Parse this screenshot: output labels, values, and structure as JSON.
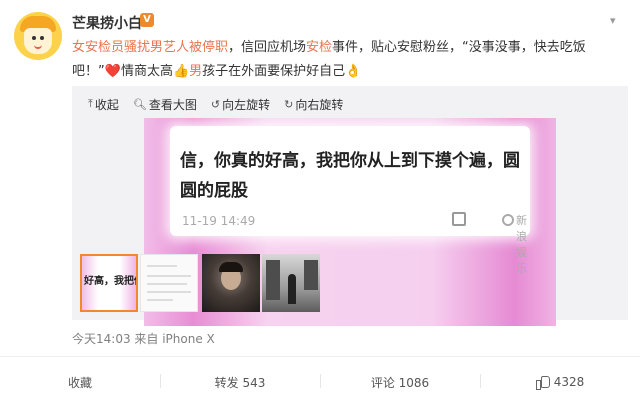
{
  "user": {
    "name": "芒果捞小白",
    "badge": "V"
  },
  "post": {
    "link_text": "女安检员骚扰男艺人被停职",
    "text_after_link": "，信回应机场",
    "highlight": "安检",
    "text_mid": "事件，贴心安慰粉丝，“没事没事，快去吃饭吧！”",
    "emoji_heart": "❤️",
    "text_after_heart": "情商太高",
    "emoji_thumb": "👍",
    "highlight2": "男",
    "text_end": "孩子在外面要保护好自己",
    "emoji_end": "👌"
  },
  "toolbar": {
    "collapse": "收起",
    "view_large": "查看大图",
    "rotate_left": "向左旋转",
    "rotate_right": "向右旋转"
  },
  "image": {
    "message": "信，你真的好高，我把你从上到下摸个遍，圆圆的屁股",
    "time": "11-19 14:49",
    "watermark": "新浪娱乐"
  },
  "thumbs": {
    "first_text": "好高，我把你从"
  },
  "meta": {
    "time_source": "今天14:03 来自 iPhone X"
  },
  "actions": {
    "favorite": "收藏",
    "repost": "转发 543",
    "comment": "评论 1086",
    "like": "4328"
  },
  "icons": {
    "collapse": "arrow-up-icon",
    "view_large": "magnifier-icon",
    "rotate_left": "rotate-left-icon",
    "rotate_right": "rotate-right-icon",
    "like": "thumbs-up-icon",
    "menu": "chevron-down-icon"
  },
  "colors": {
    "link": "#eb7350",
    "badge": "#f0892b"
  }
}
